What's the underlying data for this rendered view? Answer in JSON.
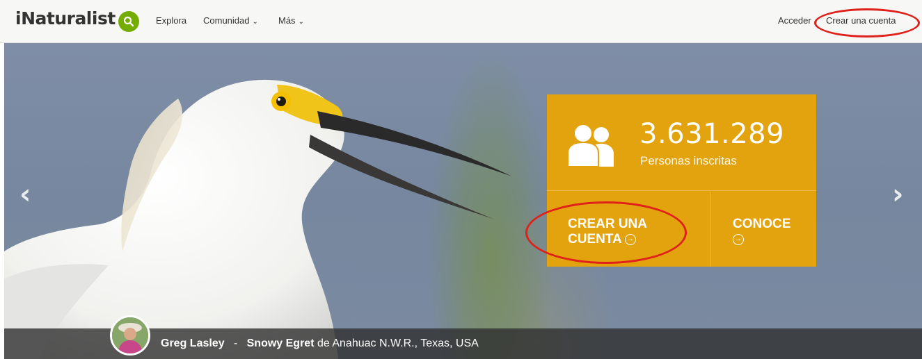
{
  "navbar": {
    "logo": "iNaturalist",
    "explore": "Explora",
    "community": "Comunidad",
    "more": "Más",
    "login": "Acceder",
    "signup": "Crear una cuenta"
  },
  "hero": {
    "stats": {
      "count": "3.631.289",
      "label": "Personas inscritas"
    },
    "create_account_line1": "CREAR UNA",
    "create_account_line2": "CUENTA",
    "learn_more": "CONOCE",
    "caption": {
      "photographer": "Greg Lasley",
      "separator": "-",
      "species": "Snowy Egret",
      "location_prefix": "de",
      "location": "Anahuac N.W.R., Texas, USA"
    }
  },
  "icons": {
    "search": "search-icon",
    "chevron": "chevron-down-icon",
    "people": "people-icon",
    "arrow_circle": "arrow-circle-right-icon",
    "prev": "chevron-left-icon",
    "next": "chevron-right-icon"
  },
  "colors": {
    "brand_green": "#74ac00",
    "card_orange": "#e2a30e",
    "annotation_red": "#e0201a"
  }
}
